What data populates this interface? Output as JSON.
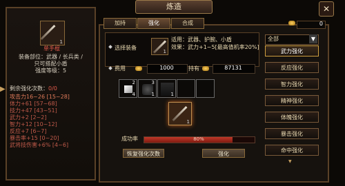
{
  "window": {
    "title": "炼造",
    "close_symbol": "✕"
  },
  "tabs": [
    {
      "label": "加持"
    },
    {
      "label": "强化"
    },
    {
      "label": "合成"
    }
  ],
  "currency": {
    "gold_amount": "0"
  },
  "left_panel": {
    "item_name": "单手棍",
    "item_count": "1",
    "equip_slot": "装备部位：武器 / 长兵类 /",
    "equip_note": "只可搭配小盾",
    "enhance_level": "强度等级：5",
    "remaining_label": "剩余强化次数：",
    "remaining_value": "0/0",
    "stats": [
      {
        "text": "攻击力16~26 [15~28]",
        "color": "#e07b5a"
      },
      {
        "text": "体力+61 [57~68]",
        "color": "#c05a4a"
      },
      {
        "text": "技力+47 [43~51]",
        "color": "#c05a4a"
      },
      {
        "text": "武力+2 [2~2]",
        "color": "#c05a4a"
      },
      {
        "text": "智力+12 [10~12]",
        "color": "#c05a4a"
      },
      {
        "text": "反应+7 [6~7]",
        "color": "#c05a4a"
      },
      {
        "text": "暴击率+15 [0~20]",
        "color": "#c05a4a"
      },
      {
        "text": "武将技伤害+6% [4~6]",
        "color": "#c05a4a"
      }
    ]
  },
  "equip_select": {
    "label": "选择装备",
    "slot_count": "1",
    "applies_to": "适用：武器、护腕、小盾",
    "effect": "效果：武力+1~5[最高值机率20%]"
  },
  "cost": {
    "label": "费用",
    "value": "1000",
    "owned_label": "持有",
    "owned_value": "87131"
  },
  "material_slots": [
    {
      "icon": "white-stone-icon",
      "top_count": "2",
      "bottom_count": "4"
    },
    {
      "icon": "dark-ore-icon",
      "top_count": "3",
      "bottom_count": "1"
    },
    {
      "icon": "black-material-icon",
      "top_count": "",
      "bottom_count": "1"
    },
    {
      "icon": "empty-slot",
      "top_count": "",
      "bottom_count": ""
    },
    {
      "icon": "empty-slot",
      "top_count": "",
      "bottom_count": ""
    }
  ],
  "result_slot_count": "1",
  "success_rate": {
    "label": "成功率",
    "value": "80%",
    "fraction": 0.8
  },
  "buttons": {
    "restore": "恢复强化次数",
    "enhance": "强化"
  },
  "dropdown": {
    "selected": "全部"
  },
  "side_buttons": [
    {
      "label": "武力强化",
      "active": true
    },
    {
      "label": "反应强化",
      "active": false
    },
    {
      "label": "智力强化",
      "active": false
    },
    {
      "label": "精神强化",
      "active": false
    },
    {
      "label": "体魄强化",
      "active": false
    },
    {
      "label": "暴击强化",
      "active": false
    },
    {
      "label": "命中强化",
      "active": false
    }
  ],
  "colors": {
    "accent_gold": "#d0a040",
    "bar_red": "#a02820",
    "text_cream": "#e8d8b0"
  }
}
